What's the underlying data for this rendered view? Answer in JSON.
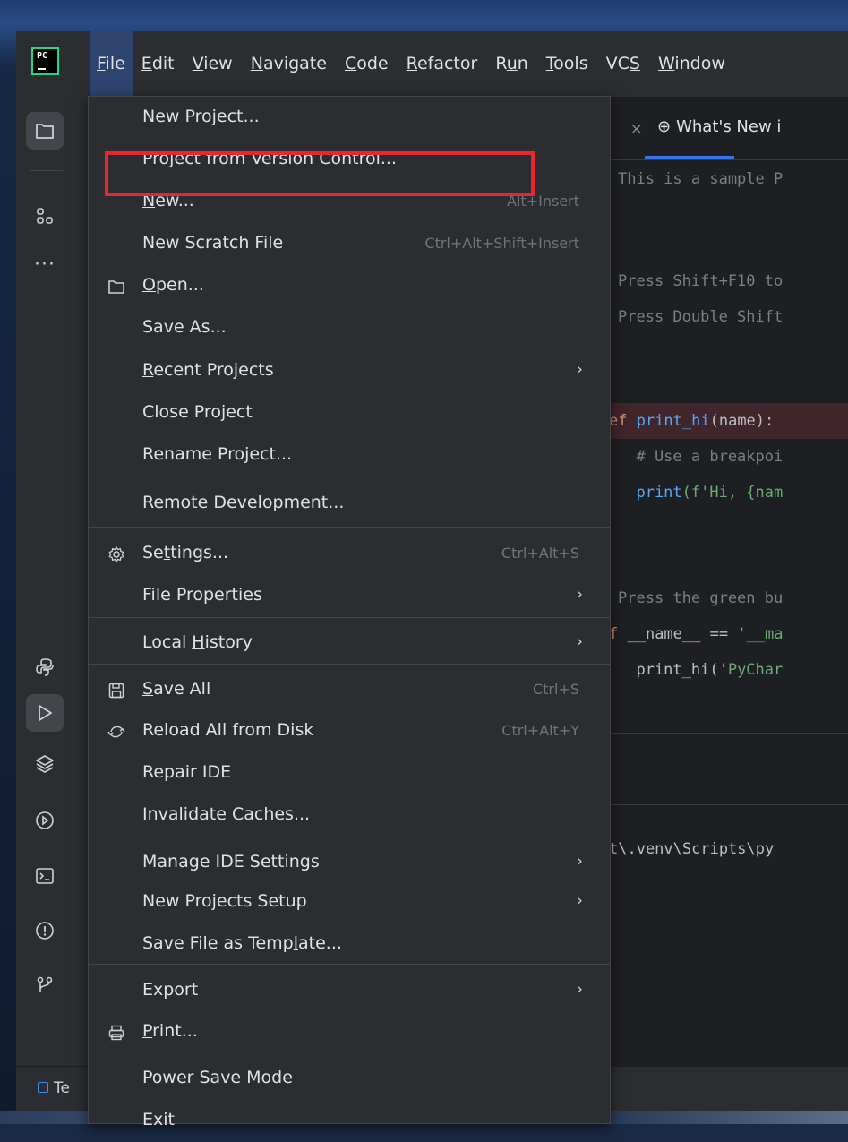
{
  "app": {
    "logo_text": "PC"
  },
  "menubar": {
    "items": [
      {
        "label": "File",
        "mnemonic_index": 0
      },
      {
        "label": "Edit",
        "mnemonic_index": 0
      },
      {
        "label": "View",
        "mnemonic_index": 0
      },
      {
        "label": "Navigate",
        "mnemonic_index": 0
      },
      {
        "label": "Code",
        "mnemonic_index": 0
      },
      {
        "label": "Refactor",
        "mnemonic_index": 0
      },
      {
        "label": "Run",
        "mnemonic_index": 1
      },
      {
        "label": "Tools",
        "mnemonic_index": 0
      },
      {
        "label": "VCS",
        "mnemonic_index": 2
      },
      {
        "label": "Window",
        "mnemonic_index": 0
      }
    ]
  },
  "file_menu": {
    "items": [
      {
        "label": "New Project...",
        "shortcut": "",
        "submenu": false,
        "icon": ""
      },
      {
        "label": "Project from Version Control...",
        "shortcut": "",
        "submenu": false,
        "icon": ""
      },
      {
        "label": "New...",
        "shortcut": "Alt+Insert",
        "submenu": false,
        "icon": ""
      },
      {
        "label": "New Scratch File",
        "shortcut": "Ctrl+Alt+Shift+Insert",
        "submenu": false,
        "icon": ""
      },
      {
        "label": "Open...",
        "shortcut": "",
        "submenu": false,
        "icon": "folder-icon"
      },
      {
        "label": "Save As...",
        "shortcut": "",
        "submenu": false,
        "icon": ""
      },
      {
        "label": "Recent Projects",
        "shortcut": "",
        "submenu": true,
        "icon": ""
      },
      {
        "label": "Close Project",
        "shortcut": "",
        "submenu": false,
        "icon": ""
      },
      {
        "label": "Rename Project...",
        "shortcut": "",
        "submenu": false,
        "icon": ""
      },
      {
        "label": "Remote Development...",
        "shortcut": "",
        "submenu": false,
        "icon": ""
      },
      {
        "label": "Settings...",
        "shortcut": "Ctrl+Alt+S",
        "submenu": false,
        "icon": "gear-icon"
      },
      {
        "label": "File Properties",
        "shortcut": "",
        "submenu": true,
        "icon": ""
      },
      {
        "label": "Local History",
        "shortcut": "",
        "submenu": true,
        "icon": ""
      },
      {
        "label": "Save All",
        "shortcut": "Ctrl+S",
        "submenu": false,
        "icon": "save-icon"
      },
      {
        "label": "Reload All from Disk",
        "shortcut": "Ctrl+Alt+Y",
        "submenu": false,
        "icon": "reload-icon"
      },
      {
        "label": "Repair IDE",
        "shortcut": "",
        "submenu": false,
        "icon": ""
      },
      {
        "label": "Invalidate Caches...",
        "shortcut": "",
        "submenu": false,
        "icon": ""
      },
      {
        "label": "Manage IDE Settings",
        "shortcut": "",
        "submenu": true,
        "icon": ""
      },
      {
        "label": "New Projects Setup",
        "shortcut": "",
        "submenu": true,
        "icon": ""
      },
      {
        "label": "Save File as Template...",
        "shortcut": "",
        "submenu": false,
        "icon": ""
      },
      {
        "label": "Export",
        "shortcut": "",
        "submenu": true,
        "icon": ""
      },
      {
        "label": "Print...",
        "shortcut": "",
        "submenu": false,
        "icon": "print-icon"
      },
      {
        "label": "Power Save Mode",
        "shortcut": "",
        "submenu": false,
        "icon": ""
      },
      {
        "label": "Exit",
        "shortcut": "",
        "submenu": false,
        "icon": ""
      }
    ],
    "highlighted_item": "Project from Version Control..."
  },
  "editor": {
    "tab_label": "What's New i",
    "lines": [
      "This is a sample P",
      "Press Shift+F10 to",
      "Press Double Shift",
      "ef print_hi(name):",
      "  # Use a breakpoi",
      "  print(f'Hi, {nam",
      "Press the green bu",
      "f __name__ == '__ma",
      "  print_hi('PyChar"
    ],
    "run_output": "t\\.venv\\Scripts\\py"
  },
  "statusbar": {
    "project_label": "Te"
  },
  "colors": {
    "highlight_box": "#e8262c",
    "accent": "#3574f0"
  }
}
